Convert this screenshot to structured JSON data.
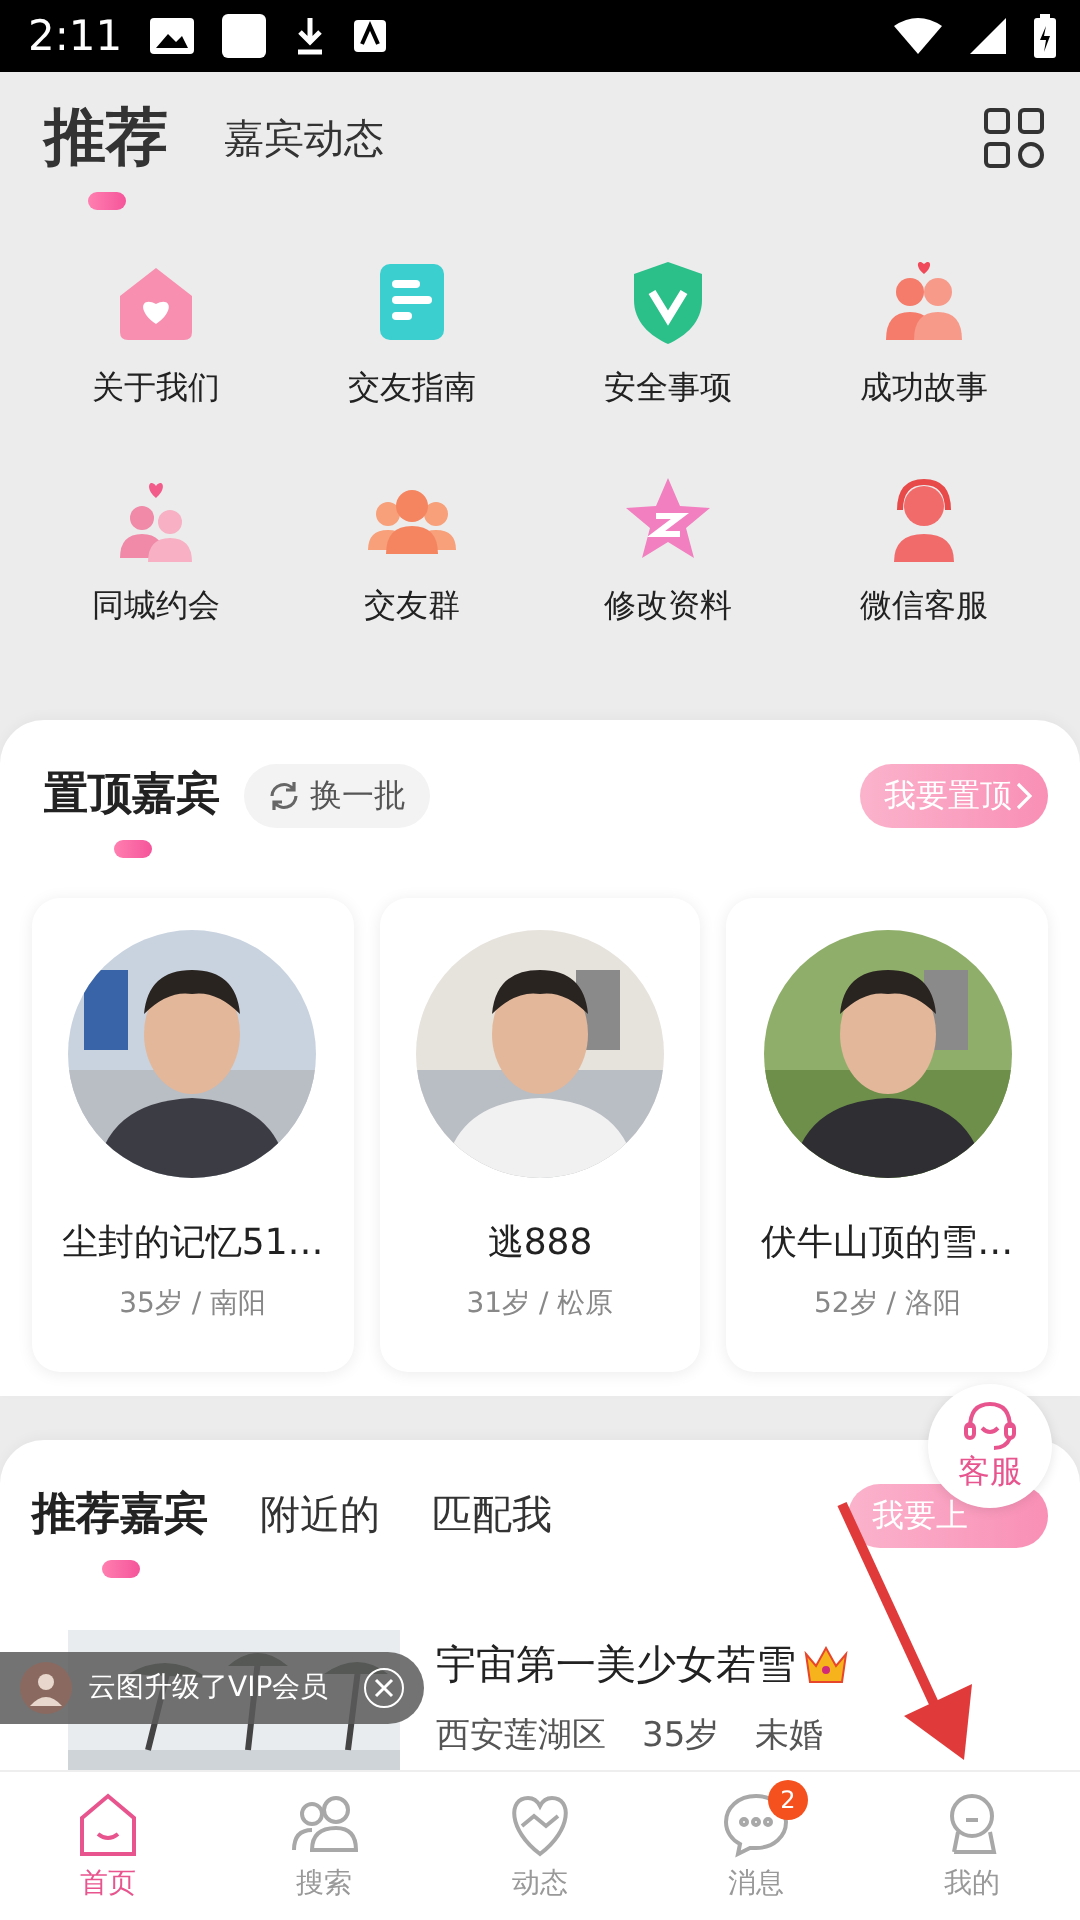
{
  "status_bar": {
    "time": "2:11"
  },
  "header": {
    "tabs": [
      {
        "label": "推荐",
        "selected": true
      },
      {
        "label": "嘉宾动态",
        "selected": false
      }
    ]
  },
  "shortcuts": [
    {
      "label": "关于我们",
      "kind": "house"
    },
    {
      "label": "交友指南",
      "kind": "guide"
    },
    {
      "label": "安全事项",
      "kind": "shield"
    },
    {
      "label": "成功故事",
      "kind": "couple"
    },
    {
      "label": "同城约会",
      "kind": "date"
    },
    {
      "label": "交友群",
      "kind": "group"
    },
    {
      "label": "修改资料",
      "kind": "star"
    },
    {
      "label": "微信客服",
      "kind": "service"
    }
  ],
  "pinned": {
    "title": "置顶嘉宾",
    "refresh": "换一批",
    "action": "我要置顶",
    "guests": [
      {
        "name": "尘封的记忆51…",
        "meta": "35岁 / 南阳"
      },
      {
        "name": "逃888",
        "meta": "31岁 / 松原"
      },
      {
        "name": "伏牛山顶的雪…",
        "meta": "52岁 / 洛阳"
      }
    ]
  },
  "recommended": {
    "tabs": [
      {
        "label": "推荐嘉宾",
        "selected": true
      },
      {
        "label": "附近的",
        "selected": false
      },
      {
        "label": "匹配我",
        "selected": false
      }
    ],
    "action": "我要上",
    "items": [
      {
        "name": "宇宙第一美少女若雪",
        "vip": true,
        "location": "西安莲湖区",
        "age": "35岁",
        "status": "未婚"
      }
    ]
  },
  "toast": {
    "text": "云图升级了VIP会员"
  },
  "support": {
    "label": "客服"
  },
  "nav": [
    {
      "label": "首页",
      "selected": true,
      "kind": "home"
    },
    {
      "label": "搜索",
      "selected": false,
      "kind": "people"
    },
    {
      "label": "动态",
      "selected": false,
      "kind": "heart"
    },
    {
      "label": "消息",
      "selected": false,
      "kind": "chat",
      "badge": "2"
    },
    {
      "label": "我的",
      "selected": false,
      "kind": "user"
    }
  ]
}
